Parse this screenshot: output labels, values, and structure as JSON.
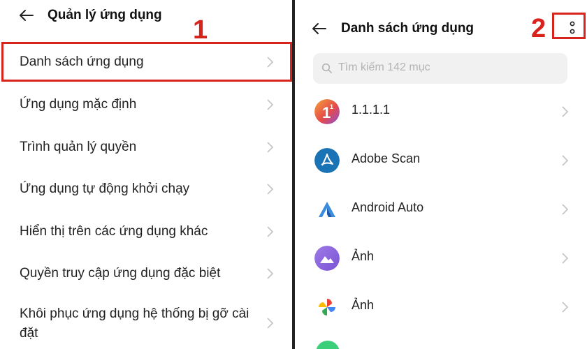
{
  "left": {
    "title": "Quản lý ứng dụng",
    "step": "1",
    "items": [
      {
        "label": "Danh sách ứng dụng"
      },
      {
        "label": "Ứng dụng mặc định"
      },
      {
        "label": "Trình quản lý quyền"
      },
      {
        "label": "Ứng dụng tự động khởi chạy"
      },
      {
        "label": "Hiển thị trên các ứng dụng khác"
      },
      {
        "label": "Quyền truy cập ứng dụng đặc biệt"
      },
      {
        "label": "Khôi phục ứng dụng hệ thống bị gỡ cài\nđặt"
      }
    ]
  },
  "right": {
    "title": "Danh sách ứng dụng",
    "step": "2",
    "search_placeholder": "Tìm kiếm 142 mục",
    "apps": [
      {
        "name": "1.1.1.1",
        "icon": "1111-icon"
      },
      {
        "name": "Adobe Scan",
        "icon": "adobe-scan-icon"
      },
      {
        "name": "Android Auto",
        "icon": "android-auto-icon"
      },
      {
        "name": "Ảnh",
        "icon": "gallery-icon"
      },
      {
        "name": "Ảnh",
        "icon": "google-photos-icon"
      }
    ]
  },
  "colors": {
    "accent": "#d8231c"
  }
}
